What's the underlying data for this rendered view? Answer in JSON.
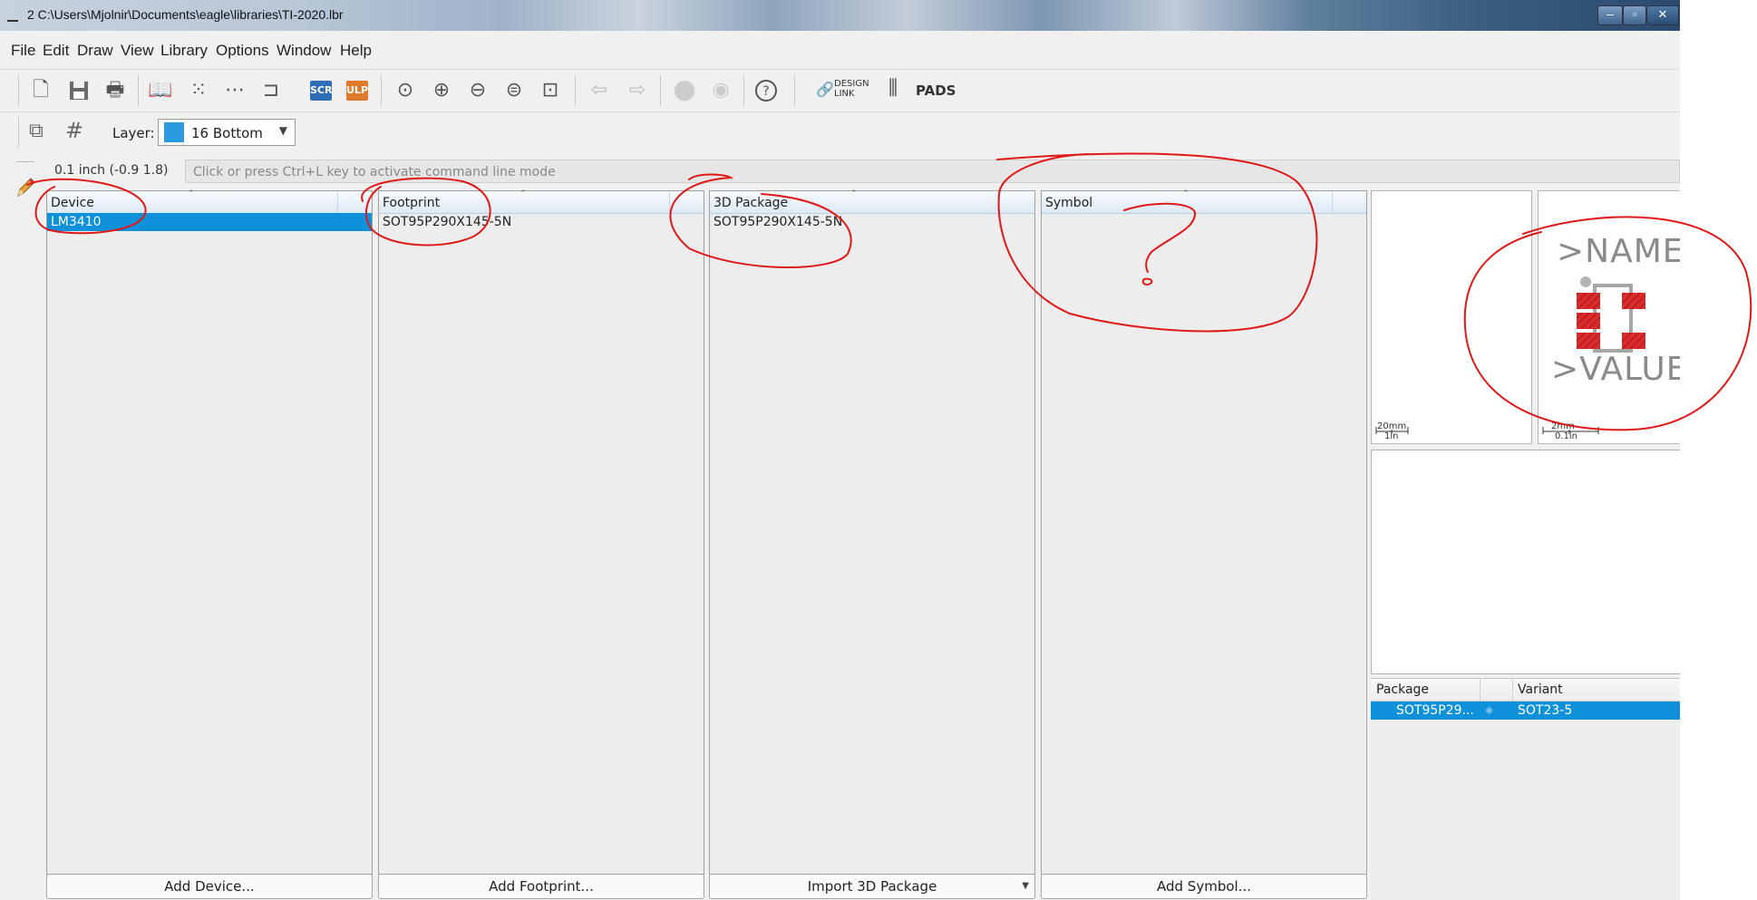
{
  "window": {
    "title": "2 C:\\Users\\Mjolnir\\Documents\\eagle\\libraries\\TI-2020.lbr"
  },
  "menu": [
    "File",
    "Edit",
    "Draw",
    "View",
    "Library",
    "Options",
    "Window",
    "Help"
  ],
  "toolbar": {
    "scr_label": "SCR",
    "ulp_label": "ULP",
    "design_link_label_1": "DESIGN",
    "design_link_label_2": "LINK",
    "pads_label": "PADS",
    "icons": [
      "new-file-icon",
      "save-icon",
      "print-icon",
      "book-icon",
      "device-grid-icon",
      "footprint-icon",
      "symbol-icon",
      "scr-icon",
      "ulp-icon",
      "zoom-fit-icon",
      "zoom-in-icon",
      "zoom-out-icon",
      "zoom-select-icon",
      "zoom-area-icon",
      "undo-icon",
      "redo-icon",
      "stop-icon",
      "go-icon",
      "help-icon"
    ],
    "colors": {
      "scr": "#2f6fb8",
      "ulp": "#e07a2a"
    }
  },
  "layerbar": {
    "layer_label": "Layer:",
    "layer_value": "16 Bottom",
    "layer_color": "#2b9ae0"
  },
  "command": {
    "coord": "0.1 inch (-0.9 1.8)",
    "placeholder": "Click or press Ctrl+L key to activate command line mode"
  },
  "panels": [
    {
      "header": "Device",
      "rows": [
        "LM3410"
      ],
      "button": "Add Device..."
    },
    {
      "header": "Footprint",
      "rows": [
        "SOT95P290X145-5N"
      ],
      "button": "Add Footprint..."
    },
    {
      "header": "3D Package",
      "rows": [
        "SOT95P290X145-5N"
      ],
      "button": "Import 3D Package"
    },
    {
      "header": "Symbol",
      "rows": [],
      "button": "Add Symbol..."
    }
  ],
  "preview": {
    "left_scale_top": "20mm",
    "left_scale_bottom": "1in",
    "right_scale_top": "2mm",
    "right_scale_bottom": "0.1in",
    "name_text": ">NAME",
    "value_text": ">VALUE",
    "pad_color": "#d92b2b"
  },
  "package_table": {
    "headers": [
      "Package",
      "Variant"
    ],
    "row": {
      "package": "SOT95P29...",
      "variant": "SOT23-5"
    }
  },
  "annotation": {
    "mark": "?",
    "color": "#e01818"
  },
  "selection_color": "#0e91d9"
}
